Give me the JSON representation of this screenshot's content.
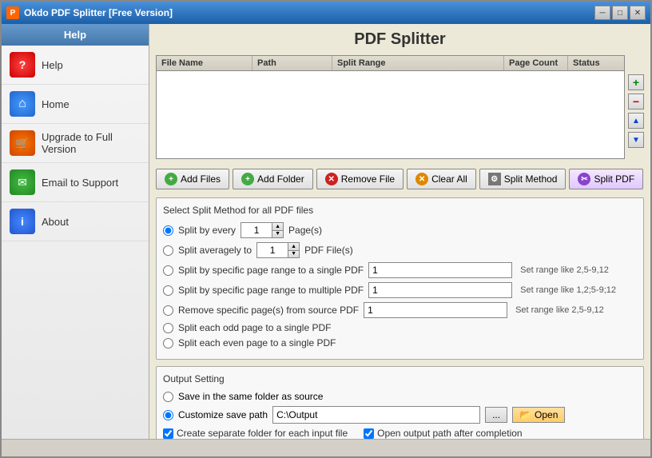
{
  "window": {
    "title": "Okdo PDF Splitter [Free Version]",
    "icon": "PDF"
  },
  "titlebar": {
    "minimize_label": "─",
    "close_label": "✕",
    "restore_label": "□"
  },
  "sidebar": {
    "header": "Help",
    "items": [
      {
        "id": "help",
        "label": "Help",
        "icon": "?"
      },
      {
        "id": "home",
        "label": "Home",
        "icon": "🏠"
      },
      {
        "id": "upgrade",
        "label": "Upgrade to Full Version",
        "icon": "🛒"
      },
      {
        "id": "email",
        "label": "Email to Support",
        "icon": "✉"
      },
      {
        "id": "about",
        "label": "About",
        "icon": "i"
      }
    ]
  },
  "main": {
    "title": "PDF Splitter",
    "file_list": {
      "columns": [
        "File Name",
        "Path",
        "Split Range",
        "Page Count",
        "Status"
      ]
    },
    "side_buttons": [
      {
        "id": "add",
        "symbol": "+",
        "color": "green"
      },
      {
        "id": "remove",
        "symbol": "−",
        "color": "red"
      },
      {
        "id": "up",
        "symbol": "▲",
        "color": "blue"
      },
      {
        "id": "down",
        "symbol": "▼",
        "color": "blue"
      }
    ],
    "action_buttons": [
      {
        "id": "add-files",
        "label": "Add Files",
        "icon": "+"
      },
      {
        "id": "add-folder",
        "label": "Add Folder",
        "icon": "+"
      },
      {
        "id": "remove-file",
        "label": "Remove File",
        "icon": "✕"
      },
      {
        "id": "clear-all",
        "label": "Clear All",
        "icon": "✕"
      },
      {
        "id": "split-method",
        "label": "Split Method",
        "icon": "⚙"
      },
      {
        "id": "split-pdf",
        "label": "Split PDF",
        "icon": "✂"
      }
    ],
    "split_section": {
      "title": "Select Split Method for all PDF files",
      "options": [
        {
          "id": "split-every",
          "label_pre": "Split by every",
          "value": "1",
          "label_post": "Page(s)",
          "selected": true
        },
        {
          "id": "split-averagely",
          "label_pre": "Split averagely to",
          "value": "1",
          "label_post": "PDF File(s)",
          "selected": false
        },
        {
          "id": "split-single",
          "label": "Split by specific page range to a single PDF",
          "range_value": "1",
          "hint": "Set range like 2,5-9,12",
          "selected": false
        },
        {
          "id": "split-multiple",
          "label": "Split by specific page range to multiple PDF",
          "range_value": "1",
          "hint": "Set range like 1,2;5-9;12",
          "selected": false
        },
        {
          "id": "remove-specific",
          "label": "Remove specific page(s) from source PDF",
          "range_value": "1",
          "hint": "Set range like 2,5-9,12",
          "selected": false
        },
        {
          "id": "odd-page",
          "label": "Split each odd page to a single PDF",
          "selected": false
        },
        {
          "id": "even-page",
          "label": "Split each even page to a single PDF",
          "selected": false
        }
      ]
    },
    "output_section": {
      "title": "Output Setting",
      "options": [
        {
          "id": "same-folder",
          "label": "Save in the same folder as source",
          "selected": false
        },
        {
          "id": "custom-path",
          "label": "Customize save path",
          "selected": true
        }
      ],
      "path_value": "C:\\Output",
      "browse_label": "...",
      "open_label": "Open",
      "checkboxes": [
        {
          "id": "separate-folder",
          "label": "Create separate folder for each input file",
          "checked": true
        },
        {
          "id": "open-output",
          "label": "Open output path after completion",
          "checked": true
        }
      ]
    }
  },
  "status_bar": {
    "text": ""
  }
}
